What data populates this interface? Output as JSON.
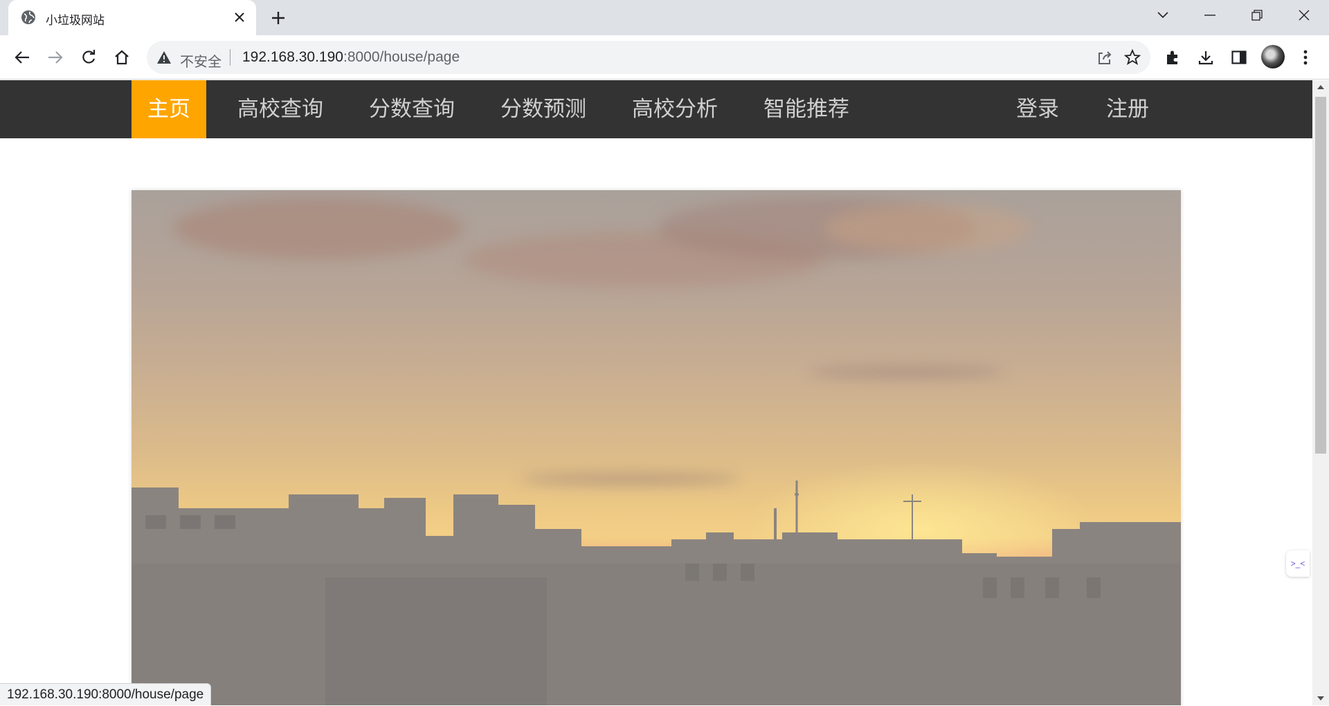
{
  "browser": {
    "tab_title": "小垃圾网站",
    "address": {
      "security_label": "不安全",
      "url_host": "192.168.30.190",
      "url_rest": ":8000/house/page"
    },
    "status_url": "192.168.30.190:8000/house/page"
  },
  "nav": {
    "items": [
      {
        "label": "主页",
        "active": true
      },
      {
        "label": "高校查询"
      },
      {
        "label": "分数查询"
      },
      {
        "label": "分数预测"
      },
      {
        "label": "高校分析"
      },
      {
        "label": "智能推荐"
      }
    ],
    "login_label": "登录",
    "register_label": "注册"
  },
  "side_widget": {
    "glyph": ">_<"
  },
  "colors": {
    "nav_bg": "#333333",
    "nav_active_bg": "#ffa500",
    "nav_text": "#d0d0d0"
  },
  "icons": [
    "globe-icon",
    "close-icon",
    "plus-icon",
    "chevron-down-icon",
    "minimize-icon",
    "restore-icon",
    "window-close-icon",
    "back-arrow-icon",
    "forward-arrow-icon",
    "reload-icon",
    "home-icon",
    "warning-icon",
    "share-icon",
    "star-icon",
    "extensions-icon",
    "download-icon",
    "side-panel-icon",
    "more-vert-icon"
  ]
}
